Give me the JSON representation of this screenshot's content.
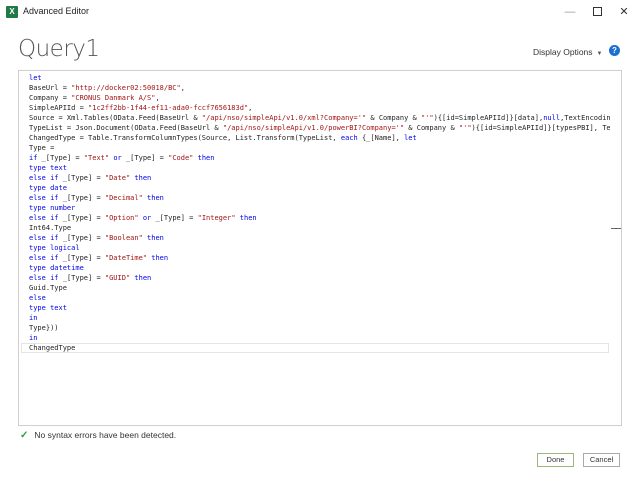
{
  "window": {
    "app_icon": "X",
    "title": "Advanced Editor",
    "controls": {
      "minimize": "—",
      "maximize": "",
      "close": "✕"
    }
  },
  "header": {
    "query_name": "Query1",
    "display_options_label": "Display Options",
    "help_glyph": "?"
  },
  "editor": {
    "lines": [
      [
        {
          "t": "let",
          "c": "k"
        }
      ],
      [
        {
          "t": "BaseUrl = "
        },
        {
          "t": "\"http://docker02:50018/BC\"",
          "c": "s"
        },
        {
          "t": ","
        }
      ],
      [
        {
          "t": "Company = "
        },
        {
          "t": "\"CRONUS Danmark A/S\"",
          "c": "s"
        },
        {
          "t": ","
        }
      ],
      [
        {
          "t": "SimpleAPIId = "
        },
        {
          "t": "\"1c2ff2bb-1f44-ef11-ada0-fccf7656183d\"",
          "c": "s"
        },
        {
          "t": ","
        }
      ],
      [
        {
          "t": "Source = Xml.Tables(OData.Feed(BaseUrl & "
        },
        {
          "t": "\"/api/nso/simpleApi/v1.0/xml?Company='\"",
          "c": "s"
        },
        {
          "t": " & Company & "
        },
        {
          "t": "\"'\"",
          "c": "s"
        },
        {
          "t": "){[id=SimpleAPIId]}[data],"
        },
        {
          "t": "null",
          "c": "k"
        },
        {
          "t": ",TextEncoding.U"
        }
      ],
      [
        {
          "t": "TypeList = Json.Document(OData.Feed(BaseUrl & "
        },
        {
          "t": "\"/api/nso/simpleApi/v1.0/powerBI?Company='\"",
          "c": "s"
        },
        {
          "t": " & Company & "
        },
        {
          "t": "\"'\"",
          "c": "s"
        },
        {
          "t": "){[id=SimpleAPIId]}[typesPBI], TextE"
        }
      ],
      [
        {
          "t": "ChangedType = Table.TransformColumnTypes(Source, List.Transform(TypeList, "
        },
        {
          "t": "each",
          "c": "k"
        },
        {
          "t": " {_[Name], "
        },
        {
          "t": "let",
          "c": "k"
        }
      ],
      [
        {
          "t": "Type ="
        }
      ],
      [
        {
          "t": "if",
          "c": "k"
        },
        {
          "t": " _[Type] = "
        },
        {
          "t": "\"Text\"",
          "c": "s"
        },
        {
          "t": " "
        },
        {
          "t": "or",
          "c": "k"
        },
        {
          "t": " _[Type] = "
        },
        {
          "t": "\"Code\"",
          "c": "s"
        },
        {
          "t": " "
        },
        {
          "t": "then",
          "c": "k"
        }
      ],
      [
        {
          "t": "type text",
          "c": "k"
        }
      ],
      [
        {
          "t": "else if",
          "c": "k"
        },
        {
          "t": " _[Type] = "
        },
        {
          "t": "\"Date\"",
          "c": "s"
        },
        {
          "t": " "
        },
        {
          "t": "then",
          "c": "k"
        }
      ],
      [
        {
          "t": "type date",
          "c": "k"
        }
      ],
      [
        {
          "t": "else if",
          "c": "k"
        },
        {
          "t": " _[Type] = "
        },
        {
          "t": "\"Decimal\"",
          "c": "s"
        },
        {
          "t": " "
        },
        {
          "t": "then",
          "c": "k"
        }
      ],
      [
        {
          "t": "type number",
          "c": "k"
        }
      ],
      [
        {
          "t": "else if",
          "c": "k"
        },
        {
          "t": " _[Type] = "
        },
        {
          "t": "\"Option\"",
          "c": "s"
        },
        {
          "t": " "
        },
        {
          "t": "or",
          "c": "k"
        },
        {
          "t": " _[Type] = "
        },
        {
          "t": "\"Integer\"",
          "c": "s"
        },
        {
          "t": " "
        },
        {
          "t": "then",
          "c": "k"
        }
      ],
      [
        {
          "t": "Int64.Type"
        }
      ],
      [
        {
          "t": "else if",
          "c": "k"
        },
        {
          "t": " _[Type] = "
        },
        {
          "t": "\"Boolean\"",
          "c": "s"
        },
        {
          "t": " "
        },
        {
          "t": "then",
          "c": "k"
        }
      ],
      [
        {
          "t": "type logical",
          "c": "k"
        }
      ],
      [
        {
          "t": "else if",
          "c": "k"
        },
        {
          "t": " _[Type] = "
        },
        {
          "t": "\"DateTime\"",
          "c": "s"
        },
        {
          "t": " "
        },
        {
          "t": "then",
          "c": "k"
        }
      ],
      [
        {
          "t": "type datetime",
          "c": "k"
        }
      ],
      [
        {
          "t": "else if",
          "c": "k"
        },
        {
          "t": " _[Type] = "
        },
        {
          "t": "\"GUID\"",
          "c": "s"
        },
        {
          "t": " "
        },
        {
          "t": "then",
          "c": "k"
        }
      ],
      [
        {
          "t": "Guid.Type"
        }
      ],
      [
        {
          "t": "else",
          "c": "k"
        }
      ],
      [
        {
          "t": "type text",
          "c": "k"
        }
      ],
      [
        {
          "t": "in",
          "c": "k"
        }
      ],
      [
        {
          "t": "Type}))"
        }
      ],
      [
        {
          "t": "in",
          "c": "k"
        }
      ],
      [
        {
          "t": "ChangedType"
        }
      ]
    ]
  },
  "status": {
    "check_glyph": "✓",
    "message": "No syntax errors have been detected."
  },
  "footer": {
    "done_label": "Done",
    "cancel_label": "Cancel"
  },
  "colors": {
    "keyword": "#0000e6",
    "string": "#a31515",
    "excel_green": "#1f7a45",
    "help_blue": "#1b6fd1",
    "success_green": "#2e9e3e"
  }
}
